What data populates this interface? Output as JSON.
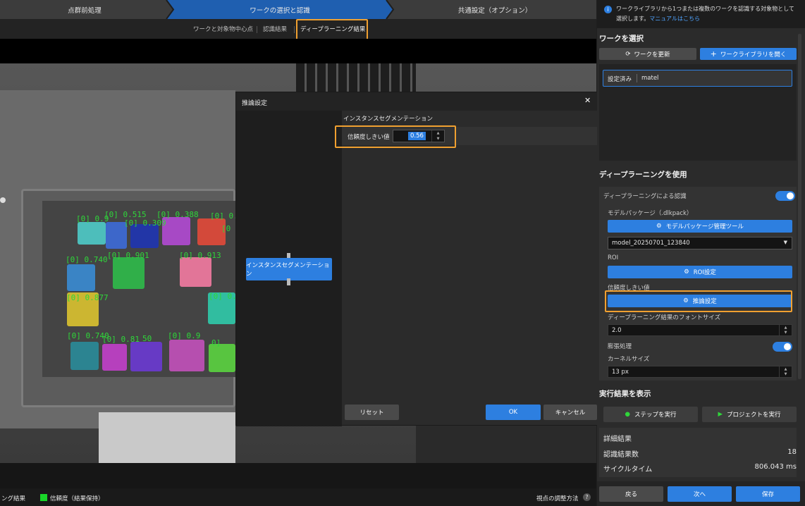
{
  "steps": [
    "点群前処理",
    "ワークの選択と認識",
    "共通設定（オプション）"
  ],
  "subtabs": [
    "ワークと対象物中心点",
    "認識結果",
    "ディープラーニング結果"
  ],
  "bottom": {
    "left_label": "ング結果",
    "legend_label": "信頼度（結果保持）",
    "help_label": "視点の調整方法",
    "help_icon": "?"
  },
  "dialog": {
    "title": "推論設定",
    "close": "✕",
    "section": "インスタンスセグメンテーション",
    "threshold_label": "信頼度しきい値",
    "threshold_value": "0.56",
    "node_label": "インスタンスセグメンテーション",
    "reset": "リセット",
    "ok": "OK",
    "cancel": "キャンセル"
  },
  "viewer_labels": [
    "[0] 0.9",
    "[0] 0.515",
    "[0] 0.388",
    "[0] 0.90",
    "[0] 0.309",
    "[0",
    "[0] 0.740",
    "[0] 0.901",
    "[0] 0.913",
    "[0] 0.877",
    "[0] 0.",
    "[0] 0.740",
    "[0] 0.81",
    "50",
    "[0] 0.9",
    "0]"
  ],
  "right": {
    "info": "ワークライブラリから1つまたは複数のワークを認識する対象物として選択します。",
    "manual_link": "マニュアルはこちら",
    "select_header": "ワークを選択",
    "update_btn": "ワークを更新",
    "open_lib_btn": "ワークライブラリを開く",
    "set_tag": "設定済み",
    "work_name": "matel",
    "dl_header": "ディープラーニングを使用",
    "dl_toggle_label": "ディープラーニングによる認識",
    "model_pkg_label": "モデルパッケージ（.dlkpack）",
    "model_tool_btn": "モデルパッケージ管理ツール",
    "model_select": "model_20250701_123840",
    "roi_label": "ROI",
    "roi_btn": "ROI設定",
    "conf_label": "信頼度しきい値",
    "infer_btn": "推論設定",
    "font_size_label": "ディープラーニング結果のフォントサイズ",
    "font_size_value": "2.0",
    "dilate_label": "膨張処理",
    "kernel_label": "カーネルサイズ",
    "kernel_value": "13 px",
    "exec_header": "実行結果を表示",
    "run_step_btn": "ステップを実行",
    "run_project_btn": "プロジェクトを実行",
    "detail_header": "詳細結果",
    "count_label": "認識結果数",
    "count_value": "18",
    "cycle_label": "サイクルタイム",
    "cycle_value": "806.043 ms",
    "back_btn": "戻る",
    "next_btn": "次へ",
    "save_btn": "保存"
  },
  "colors": {
    "accent": "#2d7fe0",
    "highlight": "#f0a030",
    "label_green": "#2fd63a"
  }
}
